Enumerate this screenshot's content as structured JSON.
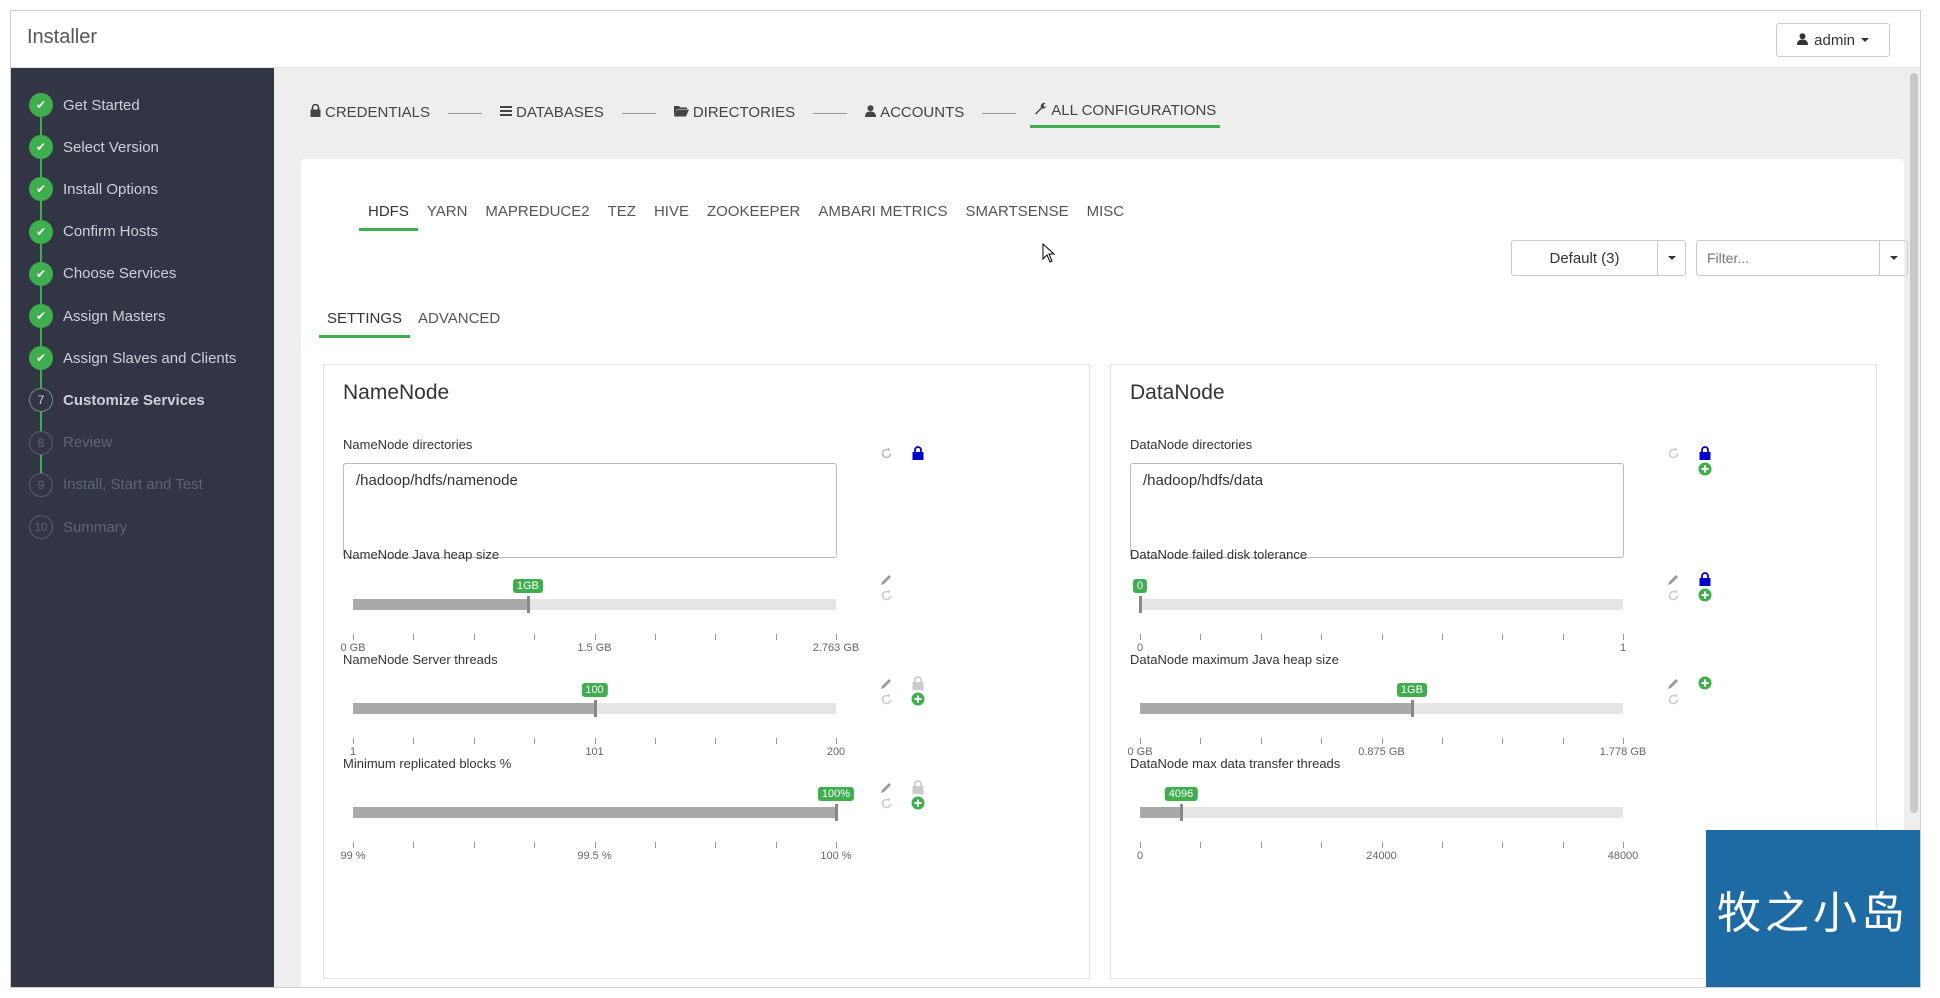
{
  "header": {
    "app_title": "Installer",
    "user_label": "admin"
  },
  "sidebar": {
    "steps": [
      {
        "label": "Get Started",
        "status": "done",
        "marker": "✔"
      },
      {
        "label": "Select Version",
        "status": "done",
        "marker": "✔"
      },
      {
        "label": "Install Options",
        "status": "done",
        "marker": "✔"
      },
      {
        "label": "Confirm Hosts",
        "status": "done",
        "marker": "✔"
      },
      {
        "label": "Choose Services",
        "status": "done",
        "marker": "✔"
      },
      {
        "label": "Assign Masters",
        "status": "done",
        "marker": "✔"
      },
      {
        "label": "Assign Slaves and Clients",
        "status": "done",
        "marker": "✔"
      },
      {
        "label": "Customize Services",
        "status": "current",
        "marker": "7"
      },
      {
        "label": "Review",
        "status": "todo",
        "marker": "8"
      },
      {
        "label": "Install, Start and Test",
        "status": "todo",
        "marker": "9"
      },
      {
        "label": "Summary",
        "status": "todo",
        "marker": "10"
      }
    ]
  },
  "wizard_tabs": [
    {
      "label": "CREDENTIALS",
      "icon": "lock-icon",
      "active": false
    },
    {
      "label": "DATABASES",
      "icon": "database-icon",
      "active": false
    },
    {
      "label": "DIRECTORIES",
      "icon": "folder-icon",
      "active": false
    },
    {
      "label": "ACCOUNTS",
      "icon": "user-icon",
      "active": false
    },
    {
      "label": "ALL CONFIGURATIONS",
      "icon": "wrench-icon",
      "active": true
    }
  ],
  "service_tabs": [
    "HDFS",
    "YARN",
    "MAPREDUCE2",
    "TEZ",
    "HIVE",
    "ZOOKEEPER",
    "AMBARI METRICS",
    "SMARTSENSE",
    "MISC"
  ],
  "service_tab_active": "HDFS",
  "config_group": {
    "label": "Default (3)"
  },
  "filter": {
    "placeholder": "Filter..."
  },
  "sub_tabs": [
    {
      "label": "SETTINGS",
      "active": true
    },
    {
      "label": "ADVANCED",
      "active": false
    }
  ],
  "namenode": {
    "title": "NameNode",
    "dirs_label": "NameNode directories",
    "dirs_value": "/hadoop/hdfs/namenode",
    "heap": {
      "label": "NameNode Java heap size",
      "value": "1GB",
      "fraction": 0.362,
      "ticks": [
        "0 GB",
        "1.5 GB",
        "2.763 GB"
      ]
    },
    "threads": {
      "label": "NameNode Server threads",
      "value": "100",
      "fraction": 0.5,
      "ticks": [
        "1",
        "101",
        "200"
      ]
    },
    "replicated": {
      "label": "Minimum replicated blocks %",
      "value": "100%",
      "fraction": 1.0,
      "ticks": [
        "99 %",
        "99.5 %",
        "100 %"
      ]
    }
  },
  "datanode": {
    "title": "DataNode",
    "dirs_label": "DataNode directories",
    "dirs_value": "/hadoop/hdfs/data",
    "tolerance": {
      "label": "DataNode failed disk tolerance",
      "value": "0",
      "fraction": 0.0,
      "ticks": [
        "0",
        "1"
      ]
    },
    "heap": {
      "label": "DataNode maximum Java heap size",
      "value": "1GB",
      "fraction": 0.563,
      "ticks": [
        "0 GB",
        "0.875 GB",
        "1.778 GB"
      ]
    },
    "threads": {
      "label": "DataNode max data transfer threads",
      "value": "4096",
      "fraction": 0.085,
      "ticks": [
        "0",
        "24000",
        "48000"
      ]
    }
  },
  "watermark": {
    "text": "牧之小岛"
  },
  "colors": {
    "accent": "#3fae4f",
    "sidebar": "#323544",
    "lock": "#0000cc",
    "watermark": "#1e6aa3"
  }
}
